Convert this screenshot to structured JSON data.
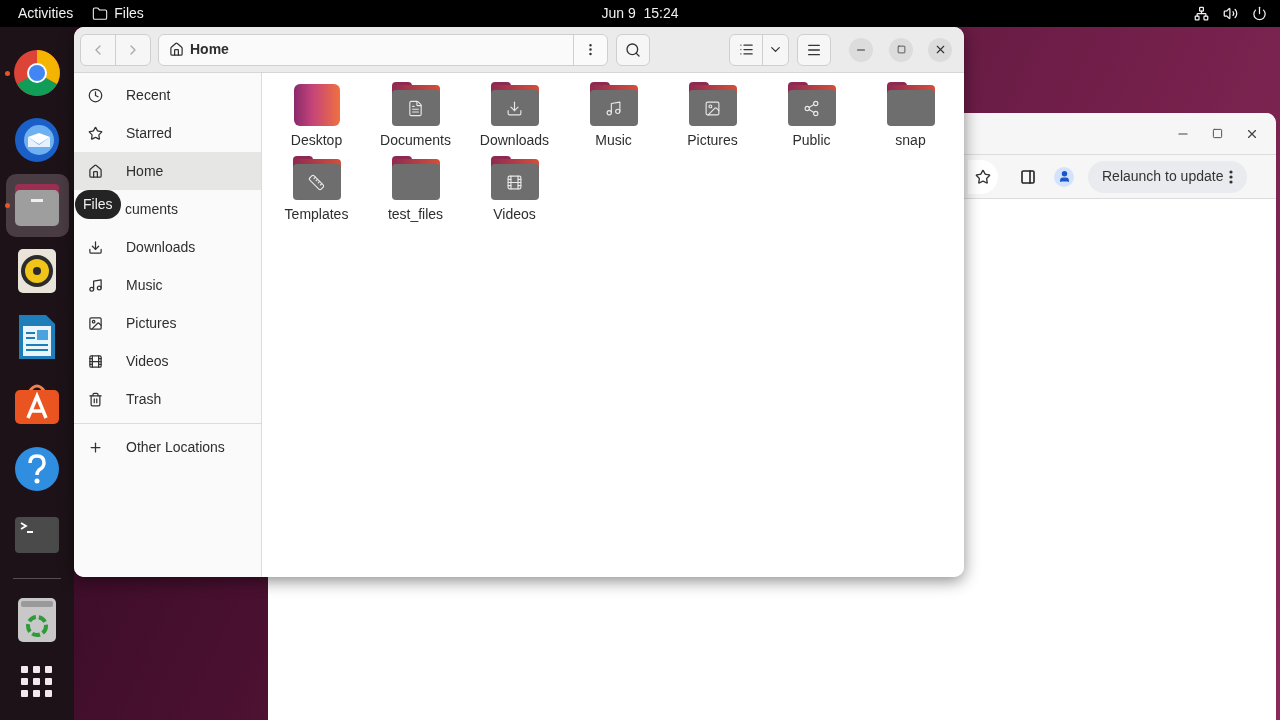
{
  "top_bar": {
    "activities": "Activities",
    "app_menu": "Files",
    "clock": "Jun 9  15:24"
  },
  "dock": {
    "items": [
      {
        "kind": "chrome",
        "running": true,
        "focused": false
      },
      {
        "kind": "mail",
        "running": false,
        "focused": false
      },
      {
        "kind": "files",
        "running": true,
        "focused": true
      },
      {
        "kind": "speaker",
        "running": false,
        "focused": false
      },
      {
        "kind": "writer",
        "running": false,
        "focused": false
      },
      {
        "kind": "store",
        "running": false,
        "focused": false
      },
      {
        "kind": "help",
        "running": false,
        "focused": false
      },
      {
        "kind": "terminal",
        "running": false,
        "focused": false
      }
    ],
    "bottom": [
      {
        "kind": "trash"
      },
      {
        "kind": "apps"
      }
    ]
  },
  "tooltip": {
    "text": "Files"
  },
  "files_window": {
    "path": "Home",
    "sidebar": {
      "places": [
        {
          "kind": "recent",
          "label": "Recent",
          "selected": false,
          "covered": false
        },
        {
          "kind": "starred",
          "label": "Starred",
          "selected": false,
          "covered": false
        },
        {
          "kind": "home",
          "label": "Home",
          "selected": true,
          "covered": false
        },
        {
          "kind": "documents",
          "label": "cuments",
          "selected": false,
          "covered": true
        },
        {
          "kind": "downloads",
          "label": "Downloads",
          "selected": false,
          "covered": false
        },
        {
          "kind": "music",
          "label": "Music",
          "selected": false,
          "covered": false
        },
        {
          "kind": "pictures",
          "label": "Pictures",
          "selected": false,
          "covered": false
        },
        {
          "kind": "videos",
          "label": "Videos",
          "selected": false,
          "covered": false
        },
        {
          "kind": "trash",
          "label": "Trash",
          "selected": false,
          "covered": false
        }
      ],
      "other": "Other Locations"
    },
    "folders": [
      {
        "kind": "desktop",
        "name": "Desktop"
      },
      {
        "kind": "documents",
        "name": "Documents"
      },
      {
        "kind": "downloads",
        "name": "Downloads"
      },
      {
        "kind": "music",
        "name": "Music"
      },
      {
        "kind": "pictures",
        "name": "Pictures"
      },
      {
        "kind": "public",
        "name": "Public"
      },
      {
        "kind": "plain",
        "name": "snap"
      },
      {
        "kind": "templates",
        "name": "Templates"
      },
      {
        "kind": "plain",
        "name": "test_files"
      },
      {
        "kind": "videos",
        "name": "Videos"
      }
    ]
  },
  "browser_window": {
    "update_button": "Relaunch to update"
  }
}
